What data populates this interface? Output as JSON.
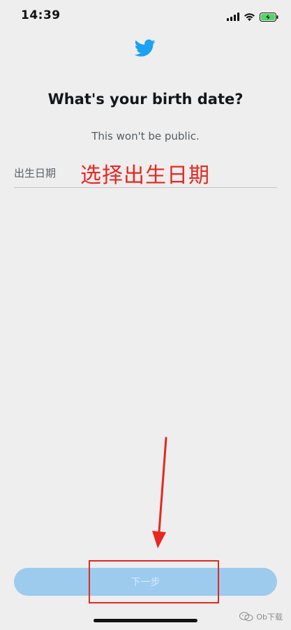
{
  "status_bar": {
    "time": "14:39",
    "icons": [
      "signal-icon",
      "wifi-icon",
      "battery-charging-icon"
    ]
  },
  "header": {
    "logo_icon": "twitter-bird-icon",
    "brand_color": "#1da1f2"
  },
  "main": {
    "title": "What's your birth date?",
    "subtitle": "This won't be public.",
    "birth_field": {
      "label": "出生日期"
    }
  },
  "annotations": {
    "overlay_text": "选择出生日期",
    "color": "#e8271f"
  },
  "footer": {
    "next_label": "下一步",
    "next_button_color": "#9ccbee"
  },
  "watermark": {
    "text": "Ob下载"
  }
}
